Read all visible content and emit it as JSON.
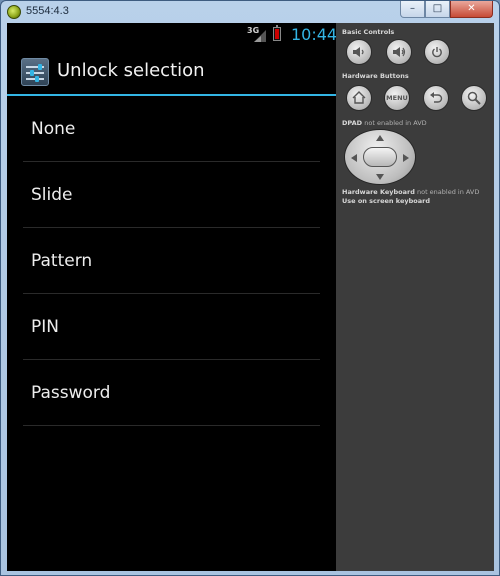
{
  "window": {
    "title": "5554:4.3",
    "minimize_glyph": "–",
    "maximize_glyph": "□",
    "close_glyph": "✕"
  },
  "statusbar": {
    "network": "3G",
    "time": "10:44"
  },
  "actionbar": {
    "title": "Unlock selection"
  },
  "options": [
    {
      "label": "None"
    },
    {
      "label": "Slide"
    },
    {
      "label": "Pattern"
    },
    {
      "label": "PIN"
    },
    {
      "label": "Password"
    }
  ],
  "controls": {
    "basic_label": "Basic Controls",
    "hardware_label": "Hardware Buttons",
    "menu_label": "MENU",
    "dpad_label": "DPAD",
    "dpad_note": "not enabled in AVD",
    "keyboard_label": "Hardware Keyboard",
    "keyboard_note": "not enabled in AVD",
    "keyboard_hint": "Use on screen keyboard"
  },
  "colors": {
    "accent": "#33b5e5",
    "screen_bg": "#000000",
    "panel_bg": "#3c3c3c"
  }
}
